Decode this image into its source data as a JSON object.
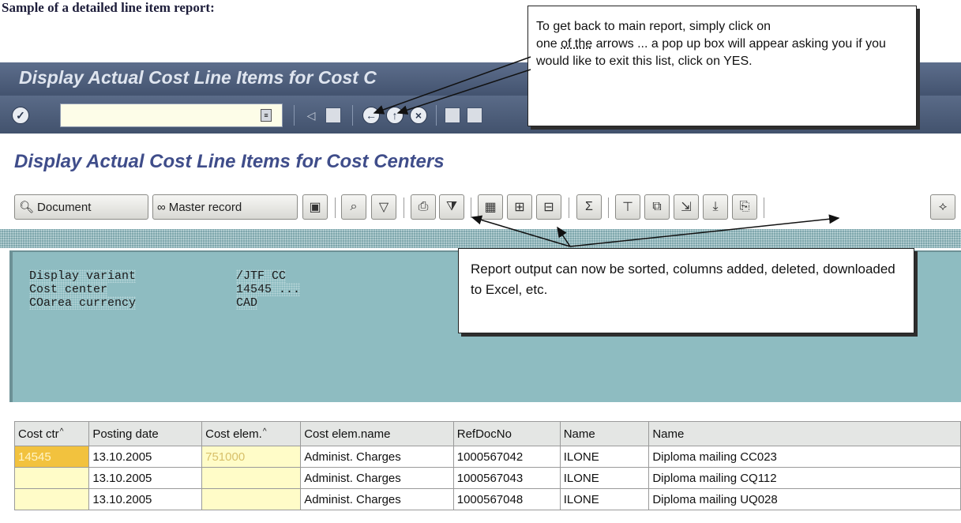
{
  "doc_heading": "Sample of a detailed line item report:",
  "window_title": "Display Actual Cost Line Items for Cost C",
  "app_title": "Display Actual Cost Line Items for Cost Centers",
  "toolbar": {
    "document_label": "Document",
    "master_record_label": "Master record"
  },
  "header_info": {
    "rows": [
      {
        "label": "Display variant",
        "value": "/JTF CC"
      },
      {
        "label": "Cost center",
        "value": "14545 ..."
      },
      {
        "label": "COarea currency",
        "value": "CAD"
      }
    ]
  },
  "grid": {
    "columns": [
      "Cost ctr",
      "Posting date",
      "Cost elem.",
      "Cost elem.name",
      "RefDocNo",
      "Name",
      "Name"
    ],
    "rows": [
      {
        "cost_ctr": "14545",
        "posting_date": "13.10.2005",
        "cost_elem": "751000",
        "cost_elem_name": "Administ. Charges",
        "ref_doc_no": "1000567042",
        "name": "ILONE",
        "name2": "Diploma mailing CC023"
      },
      {
        "cost_ctr": "",
        "posting_date": "13.10.2005",
        "cost_elem": "",
        "cost_elem_name": "Administ. Charges",
        "ref_doc_no": "1000567043",
        "name": "ILONE",
        "name2": "Diploma mailing CQ112"
      },
      {
        "cost_ctr": "",
        "posting_date": "13.10.2005",
        "cost_elem": "",
        "cost_elem_name": "Administ. Charges",
        "ref_doc_no": "1000567048",
        "name": "ILONE",
        "name2": "Diploma mailing UQ028"
      }
    ]
  },
  "callouts": {
    "back_pre": "To get back to main report, simply click on",
    "back_one": "one ",
    "back_ofthe": "of the",
    "back_rest": " arrows ... a pop up box will appear asking you if you would like to exit this list, click on YES.",
    "report": "Report output can now be sorted, columns added, deleted, downloaded to Excel, etc."
  },
  "colors": {
    "title_bar": "#4f5f7c",
    "app_title": "#3f4d8a",
    "info_panel": "#8ebcc1",
    "key_column": "#fffcc8",
    "highlight_cell": "#f2c23e"
  }
}
